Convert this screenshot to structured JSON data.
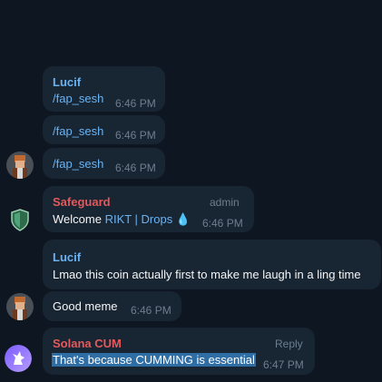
{
  "messages": [
    {
      "sender": "Lucif",
      "text": "/fap_sesh",
      "time": "6:46 PM"
    },
    {
      "text": "/fap_sesh",
      "time": "6:46 PM"
    },
    {
      "text": "/fap_sesh",
      "time": "6:46 PM"
    },
    {
      "sender": "Safeguard",
      "role": "admin",
      "text_prefix": "Welcome ",
      "mention": "RIKT | Drops",
      "emoji": "💧",
      "time": "6:46 PM"
    },
    {
      "sender": "Lucif",
      "text": "Lmao this coin actually first to make me laugh in a ling time"
    },
    {
      "text": "Good meme",
      "time": "6:46 PM"
    },
    {
      "sender": "Solana CUM",
      "action": "Reply",
      "text": "That's because CUMMING is essential",
      "time": "6:47 PM"
    }
  ],
  "colors": {
    "background": "#0e1621",
    "bubble": "#182533",
    "lucif_name": "#6ab3f3",
    "safeguard_name": "#e5595c",
    "solana_name": "#e5595c",
    "selection": "#2f6ea5"
  },
  "icons": {
    "lucif_avatar": "pixel-character-avatar",
    "safeguard_avatar": "shield-icon",
    "solana_avatar": "unicorn-avatar"
  }
}
